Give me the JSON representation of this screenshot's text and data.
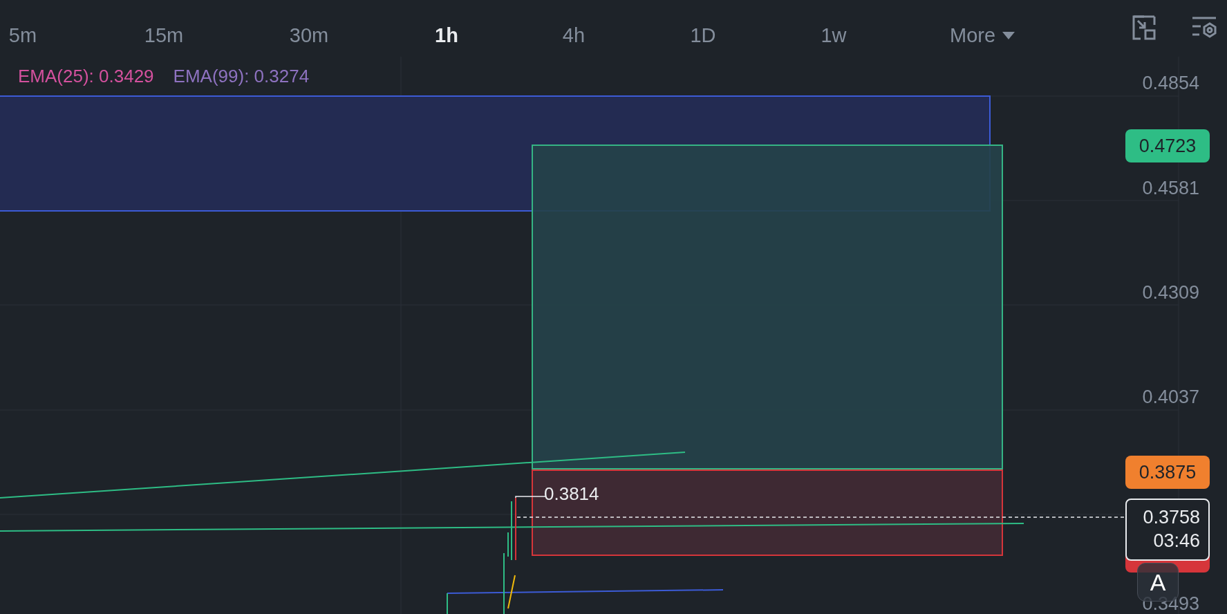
{
  "timeframes": [
    {
      "label": "5m",
      "selected": false
    },
    {
      "label": "15m",
      "selected": false
    },
    {
      "label": "30m",
      "selected": false
    },
    {
      "label": "1h",
      "selected": true
    },
    {
      "label": "4h",
      "selected": false
    },
    {
      "label": "1D",
      "selected": false
    },
    {
      "label": "1w",
      "selected": false
    }
  ],
  "more": {
    "label": "More"
  },
  "indicators": [
    {
      "text": "EMA(25): 0.3429",
      "color": "#d4519e"
    },
    {
      "text": "EMA(99): 0.3274",
      "color": "#8e72c0"
    }
  ],
  "price_axis": [
    "0.4854",
    "0.4581",
    "0.4309",
    "0.4037",
    "0.3493"
  ],
  "price_badges": [
    {
      "text": "0.4723",
      "color": "#2ebd85"
    },
    {
      "text": "0.3875",
      "color": "#f0802e"
    }
  ],
  "current_price": {
    "price": "0.3758",
    "countdown": "03:46"
  },
  "drawing_label": "0.3814",
  "floating_button": {
    "label": "A"
  }
}
